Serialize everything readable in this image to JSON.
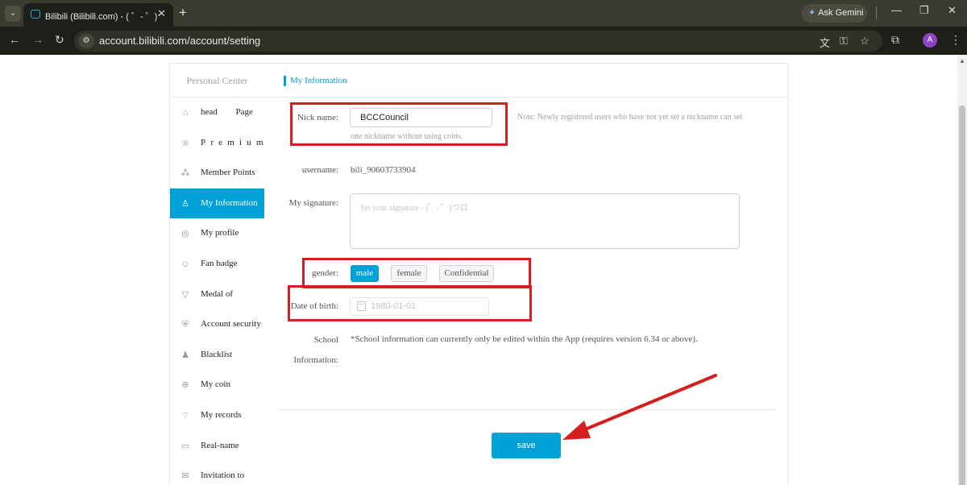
{
  "browser": {
    "tab_title": "Bilibili (Bilibili.com) - ( ゜- ゜)つロ乾",
    "url": "account.bilibili.com/account/setting",
    "gemini_label": "Ask Gemini",
    "avatar_letter": "A",
    "tab_close": "✕",
    "new_tab": "+",
    "menu_chevron": "⌄"
  },
  "sidebar": {
    "title": "Personal Center",
    "items": [
      {
        "label": "head Page",
        "icon": "home-icon"
      },
      {
        "label": "Premium",
        "icon": "premium-icon"
      },
      {
        "label": "Member Points",
        "icon": "points-icon"
      },
      {
        "label": "My Information",
        "icon": "person-icon",
        "active": true
      },
      {
        "label": "My profile",
        "icon": "profile-icon"
      },
      {
        "label": "Fan badge",
        "icon": "badge-icon"
      },
      {
        "label": "Medal of",
        "icon": "medal-icon"
      },
      {
        "label": "Account security",
        "icon": "security-icon"
      },
      {
        "label": "Blacklist",
        "icon": "blacklist-icon"
      },
      {
        "label": "My coin",
        "icon": "coin-icon"
      },
      {
        "label": "My records",
        "icon": "records-icon"
      },
      {
        "label": "Real-name",
        "icon": "realname-icon"
      },
      {
        "label": "Invitation to",
        "icon": "invitation-icon"
      }
    ]
  },
  "main": {
    "header_title": "My Information",
    "nickname": {
      "label": "Nick name:",
      "value": "BCCCouncil",
      "note": "Note: Newly registered users who have not yet set a nickname can set",
      "note_cont": "one nickname without using coins."
    },
    "username": {
      "label": "username:",
      "value": "bili_90603733904"
    },
    "signature": {
      "label": "My signature:",
      "placeholder": "Set your signature - (゜- ゜)つロ"
    },
    "gender": {
      "label": "gender:",
      "options": [
        "male",
        "female",
        "Confidential"
      ],
      "selected": "male"
    },
    "birthday": {
      "label": "Date of birth:",
      "value": "1980-01-01"
    },
    "school": {
      "label_1": "School",
      "label_2": "Information:",
      "note": "*School information can currently only be edited within the App (requires version 6.34 or above)."
    },
    "save_label": "save"
  },
  "annotation_color": "#d51f1f",
  "accent_color": "#00a1d6"
}
